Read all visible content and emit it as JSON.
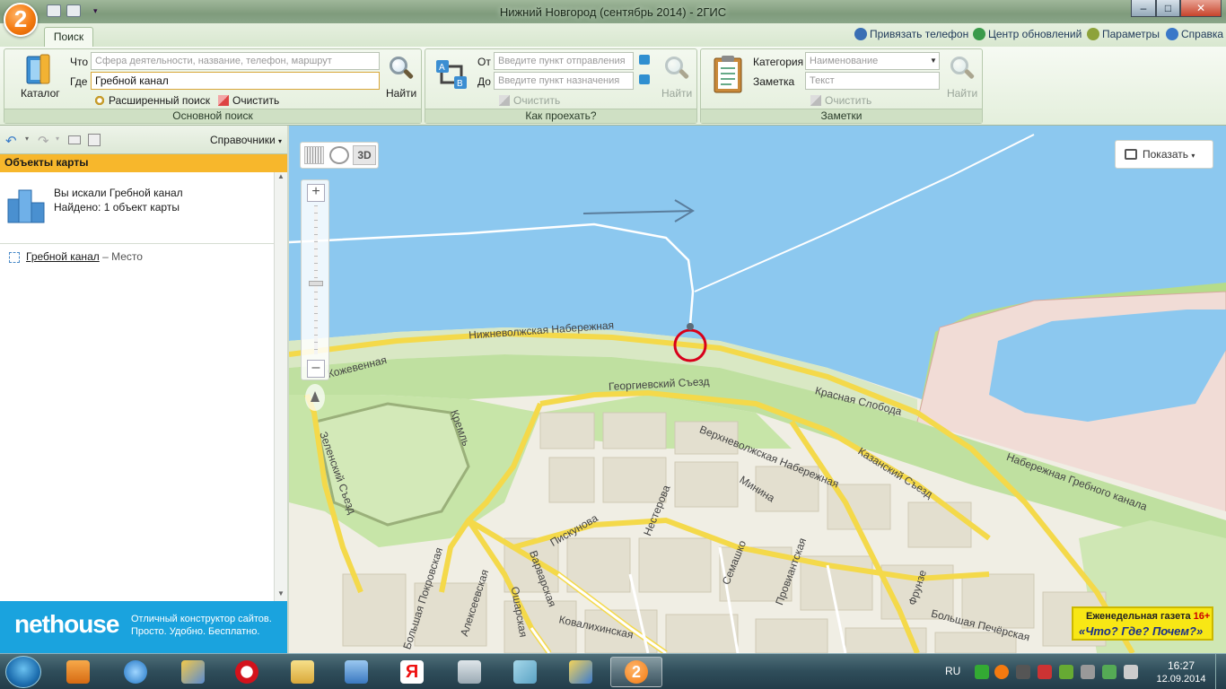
{
  "window": {
    "title": "Нижний Новгород (сентябрь 2014) - 2ГИС",
    "logo": "2",
    "buttons": {
      "minimize": "–",
      "maximize": "□",
      "close": "✕"
    }
  },
  "ribbon_tabs": {
    "active_tab": "Поиск",
    "links": {
      "bind_phone": "Привязать телефон",
      "update_center": "Центр обновлений",
      "parameters": "Параметры",
      "help": "Справка"
    }
  },
  "main_search": {
    "catalog_label": "Каталог",
    "what_label": "Что",
    "what_placeholder": "Сфера деятельности, название, телефон, маршрут",
    "where_label": "Где",
    "where_value": "Гребной канал",
    "find_label": "Найти",
    "advanced_label": "Расширенный поиск",
    "clear_label": "Очистить",
    "group_title": "Основной поиск"
  },
  "route": {
    "from_label": "От",
    "from_placeholder": "Введите пункт отправления",
    "to_label": "До",
    "to_placeholder": "Введите пункт назначения",
    "clear_label": "Очистить",
    "find_label": "Найти",
    "group_title": "Как проехать?"
  },
  "notes": {
    "category_label": "Категория",
    "category_placeholder": "Наименование",
    "note_label": "Заметка",
    "note_placeholder": "Текст",
    "clear_label": "Очистить",
    "find_label": "Найти",
    "group_title": "Заметки"
  },
  "left_panel": {
    "directories_label": "Справочники",
    "header": "Объекты карты",
    "searched_text": "Вы искали Гребной канал",
    "found_text": "Найдено: 1 объект карты",
    "result": {
      "name": "Гребной канал",
      "type": "– Место"
    }
  },
  "ad": {
    "brand": "nethouse",
    "line1": "Отличный конструктор сайтов.",
    "line2": "Просто. Удобно. Бесплатно."
  },
  "map": {
    "tool_3d": "3D",
    "show_label": "Показать",
    "zoom_in": "+",
    "zoom_out": "–",
    "streets": {
      "nizhnevolzhskaya": "Нижневолжская Набережная",
      "kozhevennaya": "Кожевенная",
      "georgievsky": "Георгиевский Съезд",
      "krasnaya_sloboda": "Красная Слобода",
      "kreml": "Кремль",
      "verkhnevolzhskaya": "Верхневолжская Набережная",
      "kazansky": "Казанский Съезд",
      "grebnogo": "Набережная Гребного канала",
      "zelensky": "Зеленский Съезд",
      "minina": "Минина",
      "nesterova": "Нестерова",
      "piskunova": "Пискунова",
      "semashko": "Семашко",
      "proviantskaya": "Провиантская",
      "varvarskaya": "Варварская",
      "pokrovskaya": "Большая Покровская",
      "alekseevskaya": "Алексеевская",
      "osharskaya": "Ошарская",
      "kovalikhinskaya": "Ковалихинская",
      "frunze": "Фрунзе",
      "pecherskaya": "Большая Печёрская"
    },
    "ad_line1": "Еженедельная газета",
    "ad_age": "16+",
    "ad_line2": "«Что? Где? Почем?»"
  },
  "taskbar": {
    "lang": "RU",
    "time": "16:27",
    "date": "12.09.2014",
    "app2gis": "2"
  }
}
